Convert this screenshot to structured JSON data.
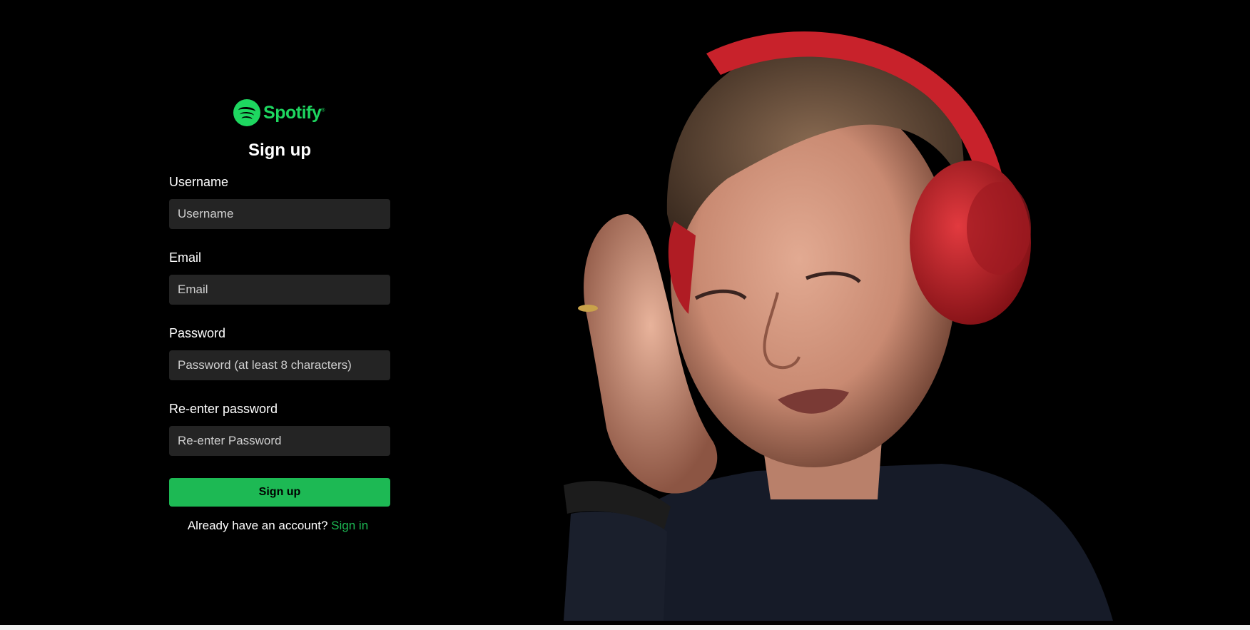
{
  "brand": {
    "name": "Spotify",
    "color": "#1ed760",
    "logo_icon": "spotify-logo-icon"
  },
  "form": {
    "title": "Sign up",
    "fields": [
      {
        "label": "Username",
        "placeholder": "Username",
        "value": ""
      },
      {
        "label": "Email",
        "placeholder": "Email",
        "value": ""
      },
      {
        "label": "Password",
        "placeholder": "Password (at least 8 characters)",
        "value": ""
      },
      {
        "label": "Re-enter password",
        "placeholder": "Re-enter Password",
        "value": ""
      }
    ],
    "submit_label": "Sign up",
    "signin_prompt": "Already have an account?",
    "signin_link": "Sign in"
  },
  "colors": {
    "background": "#000000",
    "input_bg": "#242424",
    "button": "#1db954",
    "headphones": "#d0212c"
  },
  "hero_image": {
    "subject": "woman-with-red-headphones"
  }
}
